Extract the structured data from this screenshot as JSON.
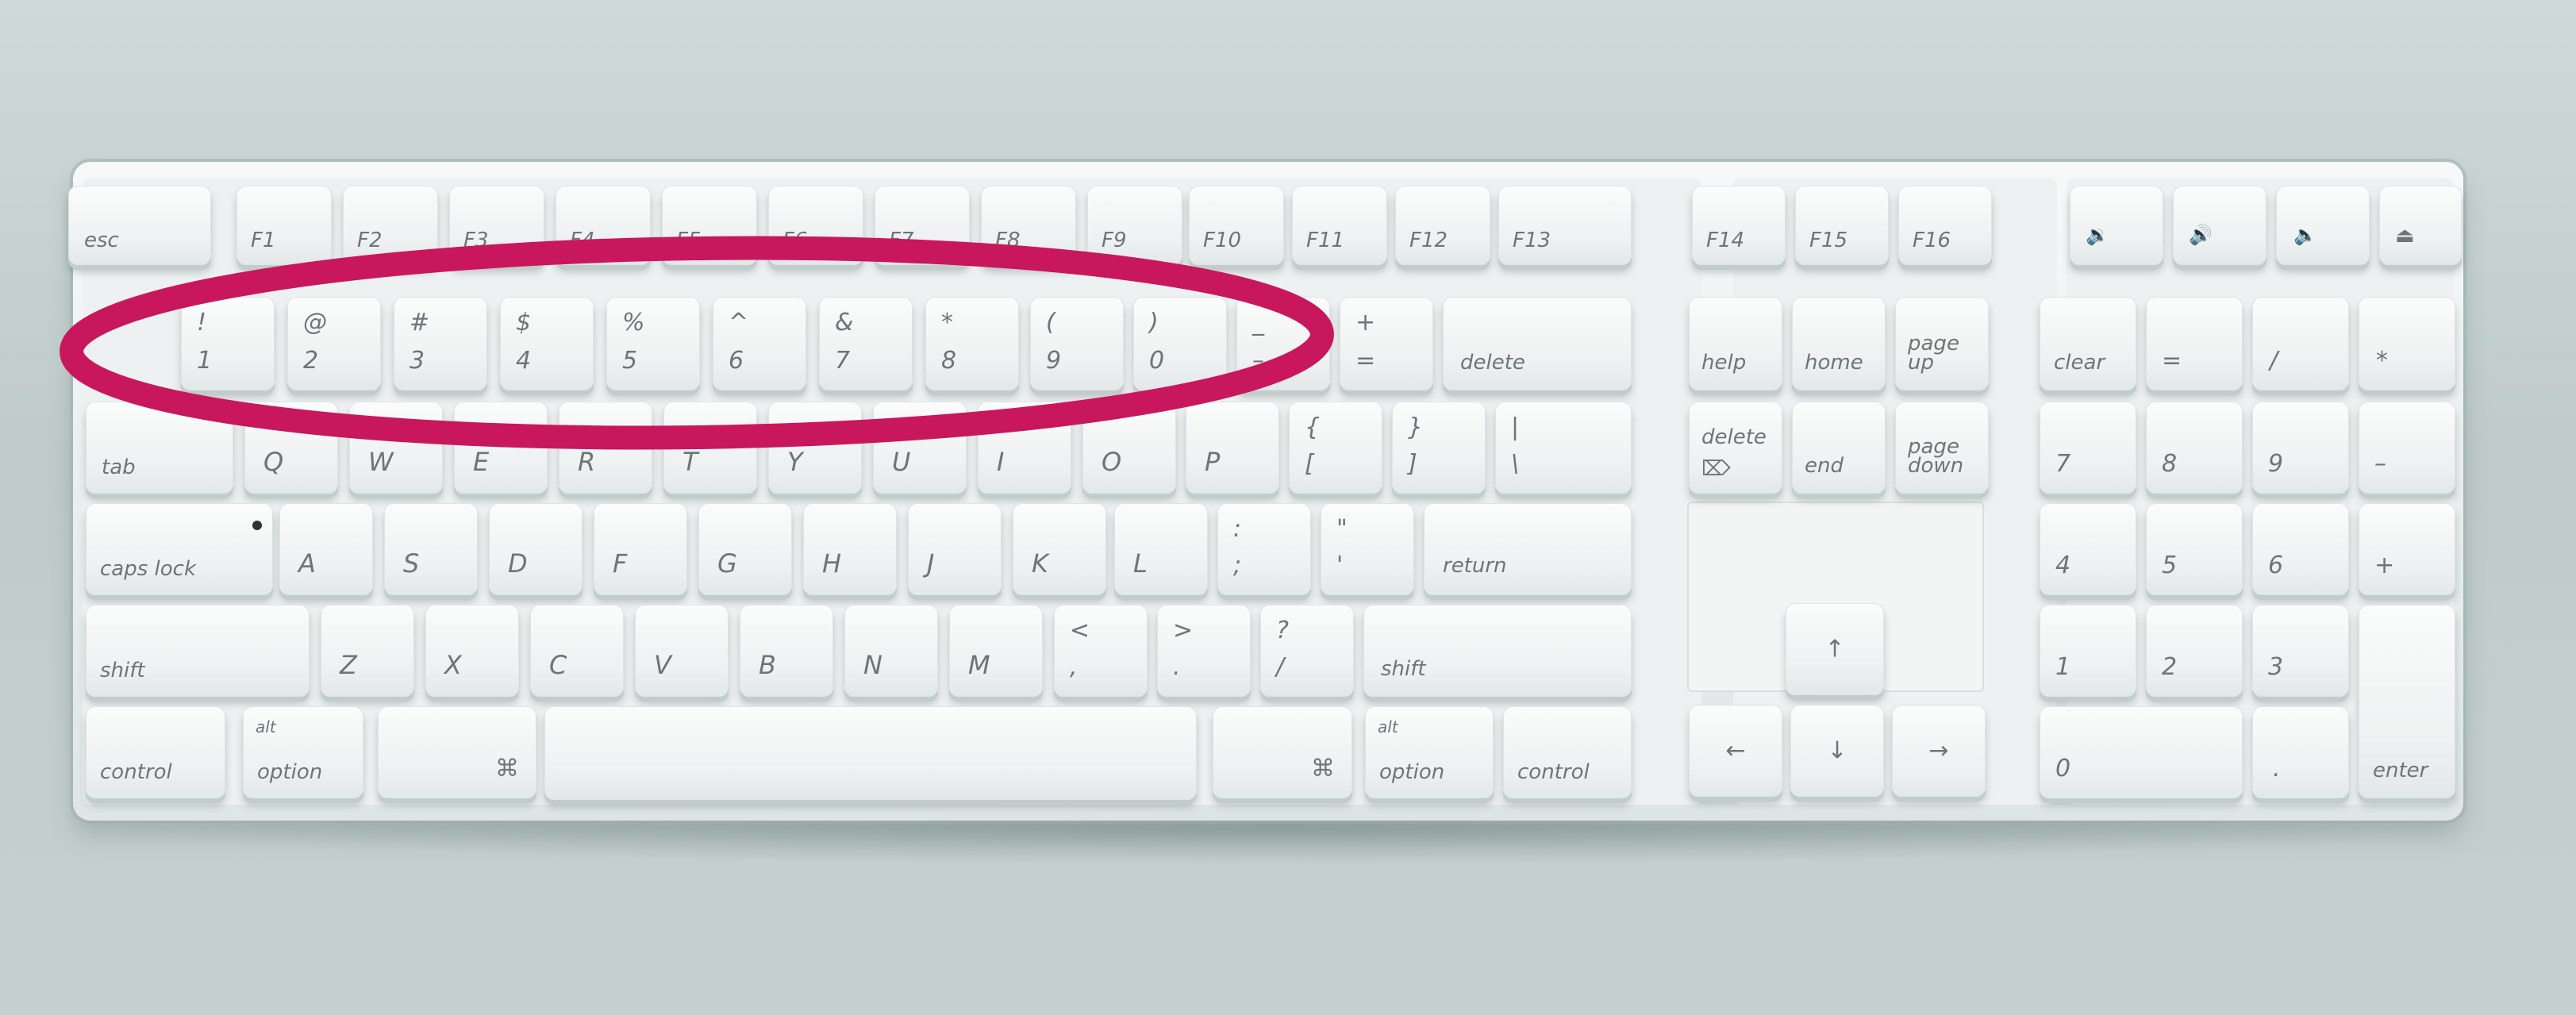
{
  "keyboard": {
    "fn_row": {
      "esc": "esc",
      "f1": "F1",
      "f2": "F2",
      "f3": "F3",
      "f4": "F4",
      "f5": "F5",
      "f6": "F6",
      "f7": "F7",
      "f8": "F8",
      "f9": "F9",
      "f10": "F10",
      "f11": "F11",
      "f12": "F12",
      "f13": "F13",
      "f14": "F14",
      "f15": "F15",
      "f16": "F16"
    },
    "media_row": {
      "vol_down": "🔉",
      "vol_up": "🔊",
      "mute": "🔈",
      "eject": "⏏"
    },
    "number_row": {
      "k1_top": "!",
      "k1": "1",
      "k2_top": "@",
      "k2": "2",
      "k3_top": "#",
      "k3": "3",
      "k4_top": "$",
      "k4": "4",
      "k5_top": "%",
      "k5": "5",
      "k6_top": "^",
      "k6": "6",
      "k7_top": "&",
      "k7": "7",
      "k8_top": "*",
      "k8": "8",
      "k9_top": "(",
      "k9": "9",
      "k0_top": ")",
      "k0": "0",
      "minus_top": "_",
      "minus": "–",
      "equal_top": "+",
      "equal": "=",
      "delete": "delete"
    },
    "qwerty_row": {
      "tab": "tab",
      "q": "Q",
      "w": "W",
      "e": "E",
      "r": "R",
      "t": "T",
      "y": "Y",
      "u": "U",
      "i": "I",
      "o": "O",
      "p": "P",
      "lbracket_top": "{",
      "lbracket": "[",
      "rbracket_top": "}",
      "rbracket": "]",
      "backslash_top": "|",
      "backslash": "\\"
    },
    "home_row": {
      "caps_lock": "caps lock",
      "a": "A",
      "s": "S",
      "d": "D",
      "f": "F",
      "g": "G",
      "h": "H",
      "j": "J",
      "k": "K",
      "l": "L",
      "semicolon_top": ":",
      "semicolon": ";",
      "quote_top": "\"",
      "quote": "'",
      "return": "return"
    },
    "shift_row": {
      "shift_left": "shift",
      "z": "Z",
      "x": "X",
      "c": "C",
      "v": "V",
      "b": "B",
      "n": "N",
      "m": "M",
      "comma_top": "<",
      "comma": ",",
      "period_top": ">",
      "period": ".",
      "slash_top": "?",
      "slash": "/",
      "shift_right": "shift"
    },
    "bottom_row": {
      "control": "control",
      "alt": "alt",
      "option": "option",
      "apple": "",
      "cmd": "⌘",
      "apple_right": "",
      "cmd_right": "⌘",
      "alt_right": "alt",
      "option_right": "option",
      "control_right": "control"
    },
    "nav_cluster": {
      "help": "help",
      "home": "home",
      "page_up": "page up",
      "delete_fwd": "delete",
      "delete_fwd_icon": "⌦",
      "end": "end",
      "page_down": "page down",
      "up": "↑",
      "left": "←",
      "down": "↓",
      "right": "→"
    },
    "numpad": {
      "clear": "clear",
      "equal": "=",
      "divide": "/",
      "multiply": "*",
      "n7": "7",
      "n8": "8",
      "n9": "9",
      "minus": "–",
      "n4": "4",
      "n5": "5",
      "n6": "6",
      "plus": "+",
      "n1": "1",
      "n2": "2",
      "n3": "3",
      "enter": "enter",
      "n0": "0",
      "decimal": "."
    }
  },
  "annotation": {
    "color": "#c8175d"
  }
}
